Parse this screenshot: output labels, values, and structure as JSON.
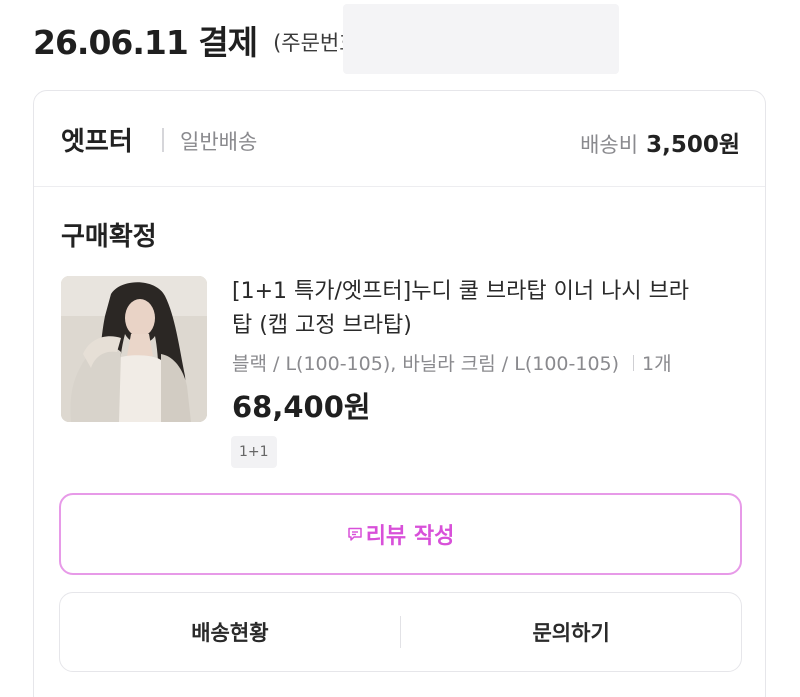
{
  "order": {
    "date_title": "26.06.11 결제",
    "order_no_label": "(주문번호"
  },
  "card": {
    "seller_name": "엣프터",
    "delivery_type": "일반배송",
    "shipping_fee_label": "배송비",
    "shipping_fee_amount": "3,500원",
    "status": "구매확정",
    "product": {
      "title_line1": "[1+1 특가/엣프터]누디 쿨 브라탑 이너 나시 브라",
      "title_line2": "탑 (캡 고정 브라탑)",
      "options": "블랙 / L(100-105), 바닐라 크림 / L(100-105)",
      "quantity": "1개",
      "price": "68,400원",
      "badge": "1+1"
    },
    "review_button_label": "리뷰 작성",
    "actions": {
      "delivery_status_label": "배송현황",
      "inquiry_label": "문의하기"
    }
  },
  "colors": {
    "accent": "#d850d9",
    "accent_border": "#e79ae8"
  }
}
